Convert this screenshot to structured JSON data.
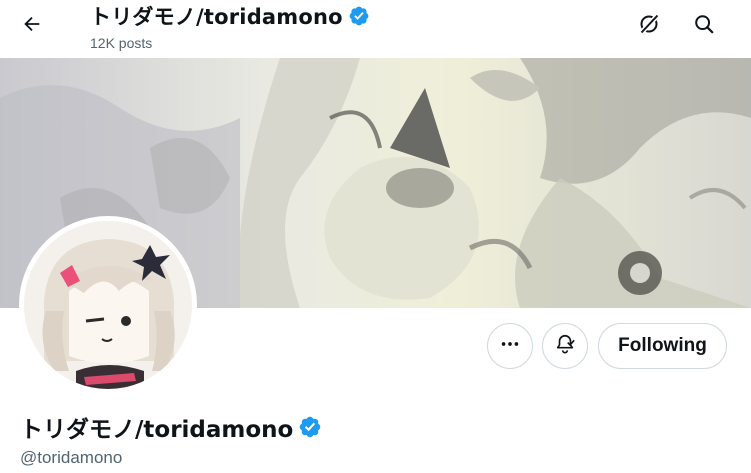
{
  "header": {
    "title": "トリダモノ/toridamono",
    "posts_count": "12K posts",
    "back_icon": "arrow-left-icon",
    "right_icons": [
      "grok-icon",
      "search-icon"
    ]
  },
  "profile": {
    "display_name": "トリダモノ/toridamono",
    "handle": "@toridamono",
    "verified": true,
    "verified_color": "#1d9bf0"
  },
  "actions": {
    "more_icon": "more-icon",
    "notifications_icon": "bell-plus-icon",
    "follow_label": "Following"
  },
  "colors": {
    "text_primary": "#0f1419",
    "text_secondary": "#536471",
    "border": "#cfd9de",
    "verified": "#1d9bf0"
  }
}
